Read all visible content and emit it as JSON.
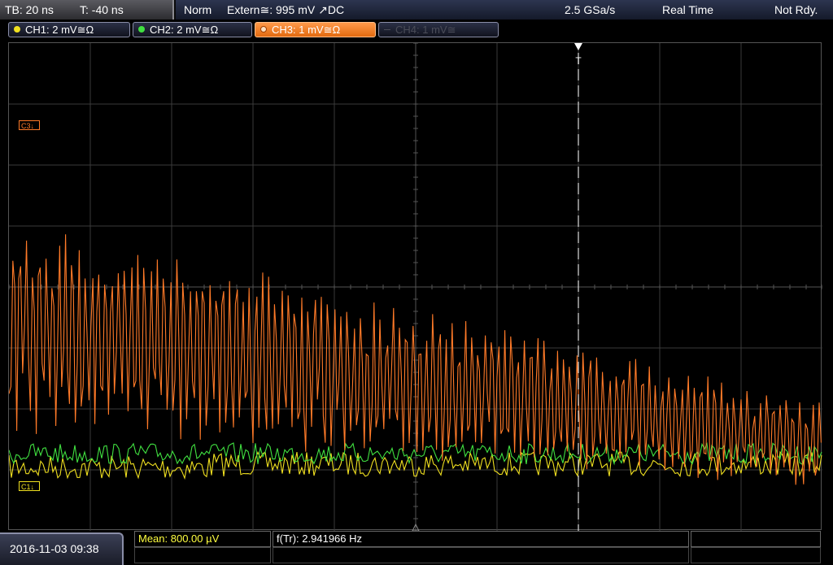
{
  "timebase": {
    "tb": "TB: 20 ns",
    "trigger_time": "T: -40 ns"
  },
  "status": {
    "mode": "Norm",
    "trigger": "Extern≅: 995 mV ↗DC",
    "sample_rate": "2.5 GSa/s",
    "acq_mode": "Real Time",
    "state": "Not Rdy."
  },
  "channels": [
    {
      "label": "CH1: 2 mV≅Ω",
      "color": "#f0e020",
      "state": "on"
    },
    {
      "label": "CH2: 2 mV≅Ω",
      "color": "#40e040",
      "state": "on"
    },
    {
      "label": "CH3: 1 mV≅Ω",
      "color": "#ff7a28",
      "state": "active"
    },
    {
      "label": "CH4: 1 mV≅",
      "color": "#4a4c58",
      "state": "off"
    }
  ],
  "markers": {
    "c3": "C3↓",
    "c1": "C1↓",
    "trigger": "T"
  },
  "measurements": {
    "mean": "Mean: 800.00 µV",
    "freq": "f(Tr): 2.941966 Hz"
  },
  "datetime": "2016-11-03 09:38",
  "colors": {
    "ch1": "#f0e020",
    "ch2": "#40e040",
    "ch3": "#ff7a28",
    "grid": "#3a3a3a"
  }
}
